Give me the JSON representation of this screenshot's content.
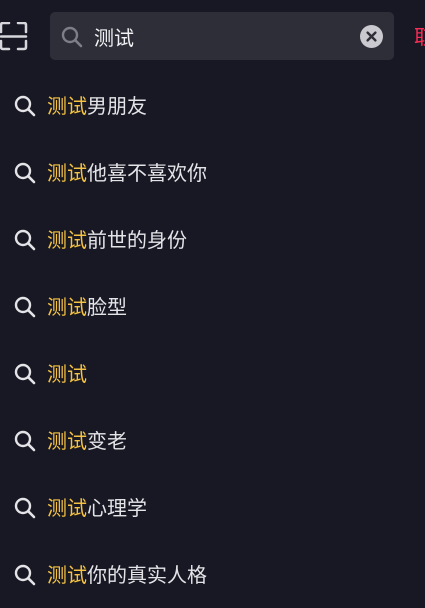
{
  "search": {
    "value": "测试",
    "cancel_label": "取消"
  },
  "suggestions": [
    {
      "highlight": "测试",
      "rest": "男朋友"
    },
    {
      "highlight": "测试",
      "rest": "他喜不喜欢你"
    },
    {
      "highlight": "测试",
      "rest": "前世的身份"
    },
    {
      "highlight": "测试",
      "rest": "脸型"
    },
    {
      "highlight": "测试",
      "rest": ""
    },
    {
      "highlight": "测试",
      "rest": "变老"
    },
    {
      "highlight": "测试",
      "rest": "心理学"
    },
    {
      "highlight": "测试",
      "rest": "你的真实人格"
    }
  ],
  "icons": {
    "scan": "scan-icon",
    "search": "search-icon",
    "clear": "clear-icon"
  },
  "colors": {
    "background": "#171823",
    "search_box": "#2d2e38",
    "highlight": "#f5c243",
    "cancel": "#fe2c55",
    "text": "#e4e4e8"
  }
}
